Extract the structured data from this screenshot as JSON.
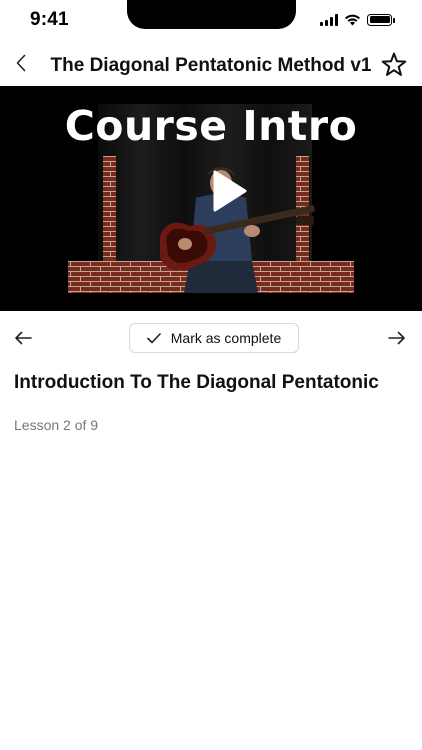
{
  "status_bar": {
    "time": "9:41"
  },
  "header": {
    "title": "The Diagonal Pentatonic Method v1",
    "back_icon": "chevron-left-icon",
    "favorite_icon": "star-outline-icon"
  },
  "video": {
    "title_overlay": "Course Intro",
    "play_icon": "play-icon"
  },
  "controls": {
    "prev_icon": "arrow-left-icon",
    "next_icon": "arrow-right-icon",
    "mark_complete_label": "Mark as complete",
    "mark_complete_icon": "checkmark-icon"
  },
  "lesson": {
    "title": "Introduction To The Diagonal Pentatonic",
    "progress": "Lesson 2 of 9"
  }
}
